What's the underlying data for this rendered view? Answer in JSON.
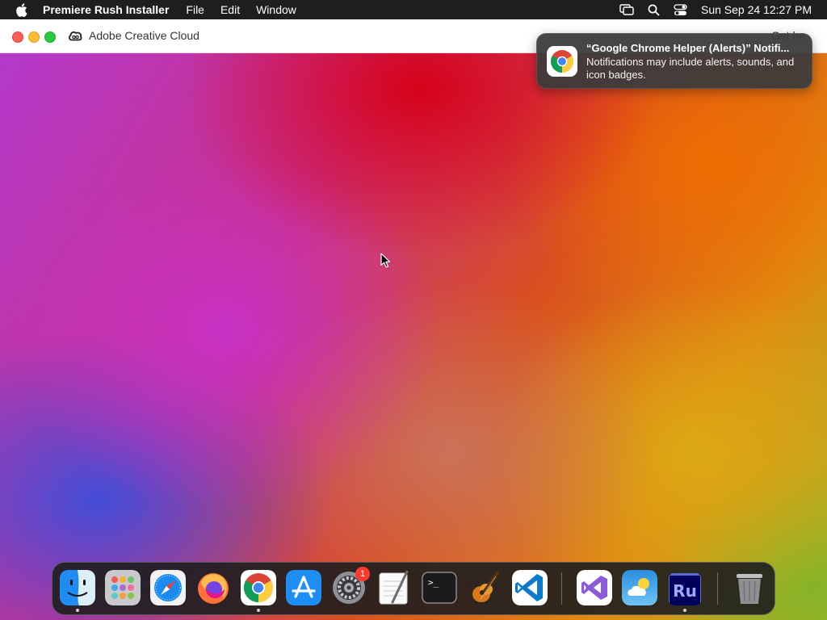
{
  "menubar": {
    "app_name": "Premiere Rush Installer",
    "menus": [
      "File",
      "Edit",
      "Window"
    ],
    "clock": "Sun Sep 24  12:27 PM",
    "icons": [
      "screen-mirroring-icon",
      "spotlight-search-icon",
      "control-center-icon"
    ]
  },
  "window": {
    "title": "Adobe Creative Cloud",
    "help_link": "Get he"
  },
  "notification": {
    "title": "“Google Chrome Helper (Alerts)” Notifi...",
    "body": "Notifications may include alerts, sounds, and icon badges.",
    "icon": "chrome-icon"
  },
  "dock": {
    "items": [
      {
        "name": "Finder",
        "icon": "finder-icon",
        "running": true
      },
      {
        "name": "Launchpad",
        "icon": "launchpad-icon",
        "running": false
      },
      {
        "name": "Safari",
        "icon": "safari-icon",
        "running": false
      },
      {
        "name": "Firefox",
        "icon": "firefox-icon",
        "running": false
      },
      {
        "name": "Google Chrome",
        "icon": "chrome-icon",
        "running": true
      },
      {
        "name": "App Store",
        "icon": "app-store-icon",
        "running": false
      },
      {
        "name": "System Preferences",
        "icon": "system-preferences-icon",
        "running": false,
        "badge": "1"
      },
      {
        "name": "TextEdit",
        "icon": "textedit-icon",
        "running": false
      },
      {
        "name": "Terminal",
        "icon": "terminal-icon",
        "running": false
      },
      {
        "name": "GarageBand",
        "icon": "garageband-icon",
        "running": false
      },
      {
        "name": "Visual Studio Code",
        "icon": "vscode-icon",
        "running": false
      },
      {
        "name": "Visual Studio",
        "icon": "visual-studio-icon",
        "running": false
      },
      {
        "name": "Weather",
        "icon": "weather-icon",
        "running": false
      },
      {
        "name": "Premiere Rush Installer",
        "icon": "premiere-rush-icon",
        "running": true,
        "label": "Ru"
      },
      {
        "name": "Trash",
        "icon": "trash-icon",
        "running": false
      }
    ],
    "badge_text": "1",
    "rush_label": "Ru",
    "terminal_prompt": ">_"
  },
  "colors": {
    "menubar_bg": "#1e1e1e",
    "close": "#fe5f57",
    "minimize": "#febc2e",
    "zoom": "#28c840",
    "notification_bg": "#3c3a3c",
    "badge": "#ff3b30"
  }
}
